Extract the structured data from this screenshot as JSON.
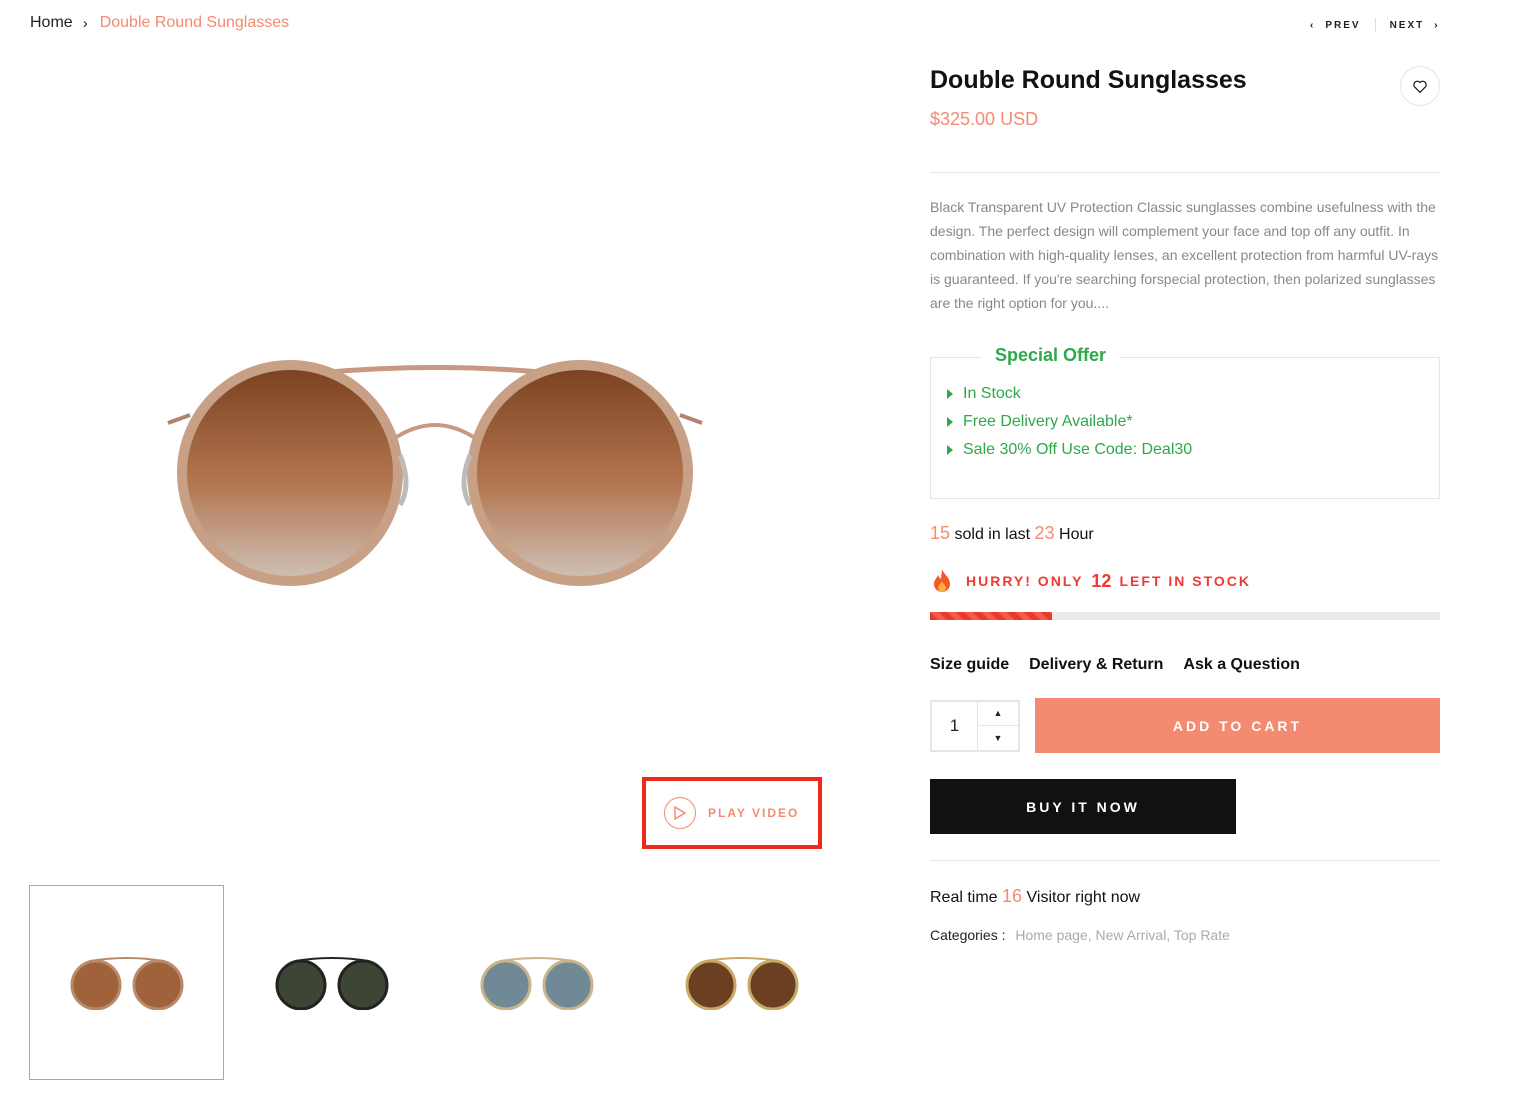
{
  "breadcrumb": {
    "home": "Home",
    "current": "Double Round Sunglasses"
  },
  "pager": {
    "prev": "PREV",
    "next": "NEXT"
  },
  "play_video": {
    "label": "PLAY VIDEO"
  },
  "product": {
    "title": "Double Round Sunglasses",
    "price": "$325.00 USD",
    "description": "Black Transparent UV Protection Classic sunglasses combine usefulness with the design. The perfect design will complement your face and top off any outfit. In combination with high-quality lenses, an excellent protection from harmful UV-rays is guaranteed. If you're searching forspecial protection, then polarized sunglasses are the right option for you...."
  },
  "offer": {
    "title": "Special Offer",
    "items": [
      "In Stock",
      "Free Delivery Available*",
      "Sale 30% Off Use Code: Deal30"
    ]
  },
  "sold": {
    "count": "15",
    "text1": "sold in last",
    "hours": "23",
    "text2": "Hour"
  },
  "stock": {
    "prefix": "HURRY! ONLY",
    "count": "12",
    "suffix": "LEFT IN STOCK",
    "level": 0.24
  },
  "links": [
    "Size guide",
    "Delivery & Return",
    "Ask a Question"
  ],
  "cart": {
    "quantity": "1",
    "add_label": "ADD TO CART",
    "buy_label": "BUY IT NOW"
  },
  "visitor": {
    "prefix": "Real time",
    "count": "16",
    "suffix": "Visitor right now"
  },
  "categories": {
    "label": "Categories :",
    "items": "Home page, New Arrival, Top Rate"
  },
  "colors": {
    "accent": "#f48a6f",
    "green": "#2ea84a",
    "red": "#ee3a30",
    "dark": "#111111"
  },
  "thumbnails": [
    {
      "name": "brown-lens",
      "lens": "#a0623a",
      "frame": "#b88a6a"
    },
    {
      "name": "green-lens",
      "lens": "#3d4535",
      "frame": "#222222"
    },
    {
      "name": "blue-lens",
      "lens": "#6f8a96",
      "frame": "#c9b38a"
    },
    {
      "name": "dark-brown-lens",
      "lens": "#6b3f22",
      "frame": "#c9a866"
    }
  ]
}
